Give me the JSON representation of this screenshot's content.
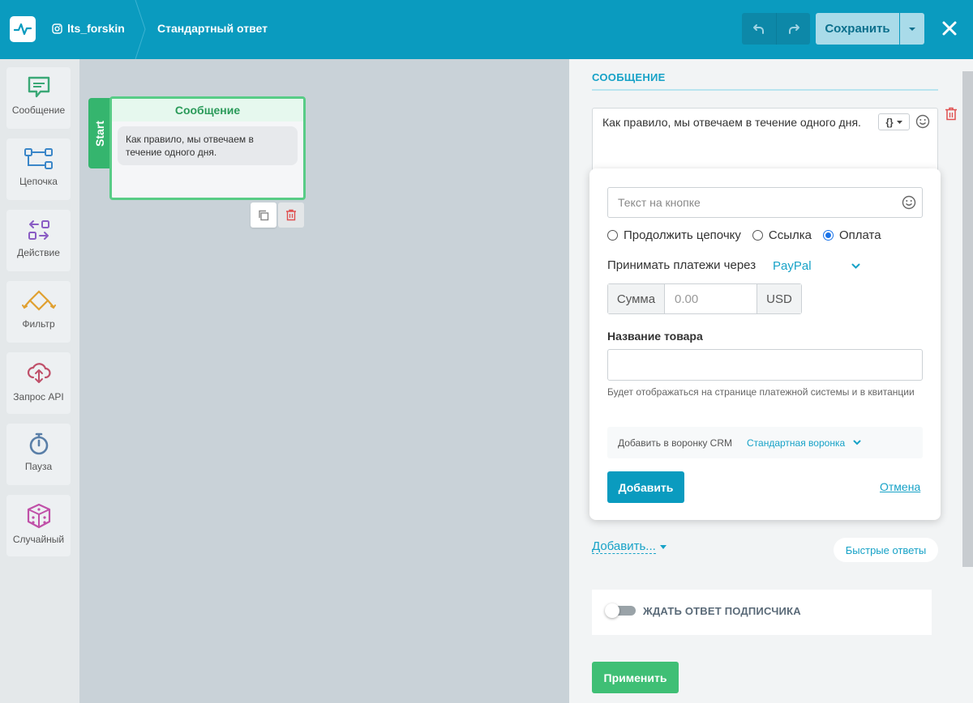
{
  "header": {
    "account": "lts_forskin",
    "title": "Стандартный ответ",
    "save_label": "Сохранить"
  },
  "sidebar": {
    "items": [
      {
        "label": "Сообщение",
        "icon": "message-icon",
        "color": "#3aa876"
      },
      {
        "label": "Цепочка",
        "icon": "chain-icon",
        "color": "#3a86c8"
      },
      {
        "label": "Действие",
        "icon": "action-icon",
        "color": "#8a5cc4"
      },
      {
        "label": "Фильтр",
        "icon": "filter-icon",
        "color": "#e0a030"
      },
      {
        "label": "Запрос API",
        "icon": "api-cloud-icon",
        "color": "#c0506a"
      },
      {
        "label": "Пауза",
        "icon": "timer-icon",
        "color": "#5a7fa8"
      },
      {
        "label": "Случайный",
        "icon": "dice-icon",
        "color": "#c050a8"
      }
    ]
  },
  "canvas": {
    "start_label": "Start",
    "node": {
      "title": "Сообщение",
      "text": "Как правило, мы отвечаем в течение одного дня."
    }
  },
  "panel": {
    "section_title": "СООБЩЕНИЕ",
    "message_text": "Как правило, мы отвечаем в течение одного дня.",
    "var_button": "{}",
    "button_form": {
      "text_placeholder": "Текст на кнопке",
      "radios": [
        {
          "label": "Продолжить цепочку",
          "checked": false
        },
        {
          "label": "Ссылка",
          "checked": false
        },
        {
          "label": "Оплата",
          "checked": true
        }
      ],
      "payment_label": "Принимать платежи через",
      "payment_provider": "PayPal",
      "sum_label": "Сумма",
      "sum_placeholder": "0.00",
      "currency": "USD",
      "product_label": "Название товара",
      "product_hint": "Будет отображаться на странице платежной системы и в квитанции",
      "crm_label": "Добавить в воронку CRM",
      "crm_value": "Стандартная воронка",
      "add_label": "Добавить",
      "cancel_label": "Отмена"
    },
    "add_more_label": "Добавить...",
    "quick_replies_label": "Быстрые ответы",
    "wait_reply_label": "ЖДАТЬ ОТВЕТ ПОДПИСЧИКА",
    "wait_reply_enabled": false,
    "apply_label": "Применить"
  },
  "colors": {
    "header": "#0a9bbf",
    "accent": "#17a2c7",
    "green": "#3fbf75"
  }
}
